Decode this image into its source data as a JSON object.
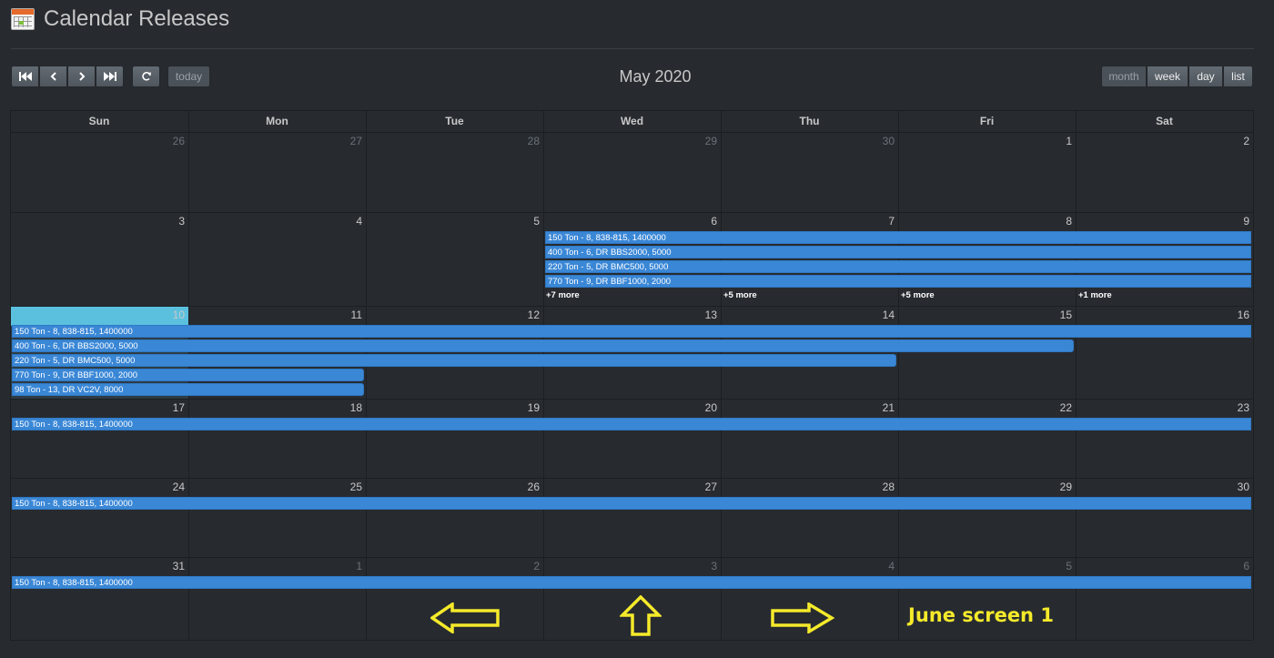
{
  "header": {
    "title": "Calendar Releases"
  },
  "toolbar": {
    "today_label": "today",
    "views": [
      "month",
      "week",
      "day",
      "list"
    ],
    "active_view": "month",
    "month_title": "May 2020"
  },
  "calendar": {
    "day_names": [
      "Sun",
      "Mon",
      "Tue",
      "Wed",
      "Thu",
      "Fri",
      "Sat"
    ],
    "weeks": [
      {
        "days": [
          "26",
          "27",
          "28",
          "29",
          "30",
          "1",
          "2"
        ],
        "other": [
          true,
          true,
          true,
          true,
          true,
          false,
          false
        ]
      },
      {
        "days": [
          "3",
          "4",
          "5",
          "6",
          "7",
          "8",
          "9"
        ],
        "other": [
          false,
          false,
          false,
          false,
          false,
          false,
          false
        ]
      },
      {
        "days": [
          "10",
          "11",
          "12",
          "13",
          "14",
          "15",
          "16"
        ],
        "other": [
          false,
          false,
          false,
          false,
          false,
          false,
          false
        ]
      },
      {
        "days": [
          "17",
          "18",
          "19",
          "20",
          "21",
          "22",
          "23"
        ],
        "other": [
          false,
          false,
          false,
          false,
          false,
          false,
          false
        ]
      },
      {
        "days": [
          "24",
          "25",
          "26",
          "27",
          "28",
          "29",
          "30"
        ],
        "other": [
          false,
          false,
          false,
          false,
          false,
          false,
          false
        ]
      },
      {
        "days": [
          "31",
          "1",
          "2",
          "3",
          "4",
          "5",
          "6"
        ],
        "other": [
          false,
          true,
          true,
          true,
          true,
          true,
          true
        ]
      }
    ],
    "events": [
      {
        "title": "150 Ton - 8, 838-815, 1400000",
        "week": 1,
        "start": 3,
        "end": 6,
        "row": 0
      },
      {
        "title": "400 Ton - 6, DR BBS2000, 5000",
        "week": 1,
        "start": 3,
        "end": 6,
        "row": 1
      },
      {
        "title": "220 Ton - 5, DR BMC500, 5000",
        "week": 1,
        "start": 3,
        "end": 6,
        "row": 2
      },
      {
        "title": "770 Ton - 9, DR BBF1000, 2000",
        "week": 1,
        "start": 3,
        "end": 6,
        "row": 3
      },
      {
        "title": "150 Ton - 8, 838-815, 1400000",
        "week": 2,
        "start": 0,
        "end": 6,
        "row": 0
      },
      {
        "title": "400 Ton - 6, DR BBS2000, 5000",
        "week": 2,
        "start": 0,
        "end": 5,
        "row": 1,
        "ends_here": true
      },
      {
        "title": "220 Ton - 5, DR BMC500, 5000",
        "week": 2,
        "start": 0,
        "end": 4,
        "row": 2,
        "ends_here": true
      },
      {
        "title": "770 Ton - 9, DR BBF1000, 2000",
        "week": 2,
        "start": 0,
        "end": 1,
        "row": 3,
        "ends_here": true
      },
      {
        "title": "98 Ton - 13, DR VC2V, 8000",
        "week": 2,
        "start": 0,
        "end": 1,
        "row": 4,
        "ends_here": true
      },
      {
        "title": "150 Ton - 8, 838-815, 1400000",
        "week": 3,
        "start": 0,
        "end": 6,
        "row": 0
      },
      {
        "title": "150 Ton - 8, 838-815, 1400000",
        "week": 4,
        "start": 0,
        "end": 6,
        "row": 0
      },
      {
        "title": "150 Ton - 8, 838-815, 1400000",
        "week": 5,
        "start": 0,
        "end": 6,
        "row": 0
      }
    ],
    "more_links": [
      {
        "label": "+7 more",
        "week": 1,
        "col": 3
      },
      {
        "label": "+5 more",
        "week": 1,
        "col": 4
      },
      {
        "label": "+5 more",
        "week": 1,
        "col": 5
      },
      {
        "label": "+1 more",
        "week": 1,
        "col": 6
      }
    ],
    "today": {
      "week": 2,
      "col": 0
    }
  },
  "annotation": {
    "text": "June screen 1",
    "arrows": [
      "left-arrow-icon",
      "up-arrow-icon",
      "right-arrow-icon"
    ],
    "color": "#f5ea2a"
  },
  "colors": {
    "event": "#3a87d6",
    "today": "#5bc0de",
    "background": "#272b30"
  }
}
